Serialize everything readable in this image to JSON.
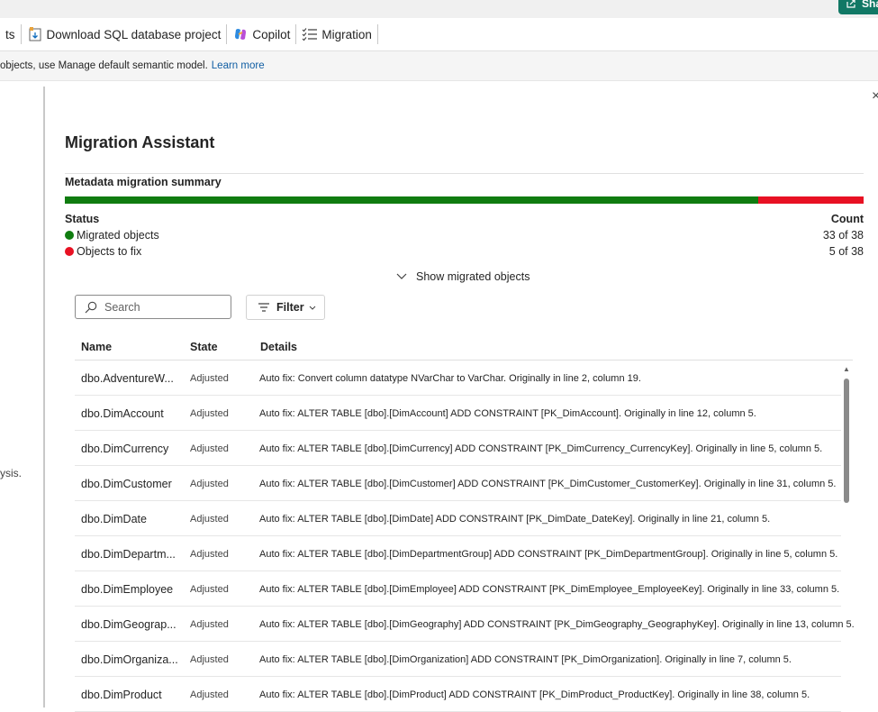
{
  "share": {
    "label": "Sha"
  },
  "toolbar": {
    "items": [
      {
        "label": "ts",
        "icon": "none"
      },
      {
        "label": "Download SQL database project",
        "icon": "download-project-icon"
      },
      {
        "label": "Copilot",
        "icon": "copilot-icon"
      },
      {
        "label": "Migration",
        "icon": "migration-list-icon"
      }
    ]
  },
  "infobar": {
    "text": "objects, use Manage default semantic model.",
    "link": "Learn more"
  },
  "leftpane": {
    "fragment": "ysis."
  },
  "panel": {
    "close": "×",
    "title": "Migration Assistant",
    "summary_title": "Metadata migration summary",
    "progress": {
      "migrated_fraction": 0.868
    },
    "status_header": "Status",
    "count_header": "Count",
    "statuses": [
      {
        "label": "Migrated objects",
        "count": "33 of 38",
        "color": "#107c10"
      },
      {
        "label": "Objects to fix",
        "count": "5 of 38",
        "color": "#e81123"
      }
    ],
    "show_migrated": "Show migrated objects",
    "search_placeholder": "Search",
    "filter_label": "Filter",
    "columns": {
      "name": "Name",
      "state": "State",
      "details": "Details"
    },
    "rows": [
      {
        "name": "dbo.AdventureW...",
        "state": "Adjusted",
        "details": "Auto fix: Convert column datatype NVarChar to VarChar. Originally in line 2, column 19."
      },
      {
        "name": "dbo.DimAccount",
        "state": "Adjusted",
        "details": "Auto fix: ALTER TABLE [dbo].[DimAccount] ADD CONSTRAINT [PK_DimAccount]. Originally in line 12, column 5."
      },
      {
        "name": "dbo.DimCurrency",
        "state": "Adjusted",
        "details": "Auto fix: ALTER TABLE [dbo].[DimCurrency] ADD CONSTRAINT [PK_DimCurrency_CurrencyKey]. Originally in line 5, column 5."
      },
      {
        "name": "dbo.DimCustomer",
        "state": "Adjusted",
        "details": "Auto fix: ALTER TABLE [dbo].[DimCustomer] ADD CONSTRAINT [PK_DimCustomer_CustomerKey]. Originally in line 31, column 5."
      },
      {
        "name": "dbo.DimDate",
        "state": "Adjusted",
        "details": "Auto fix: ALTER TABLE [dbo].[DimDate] ADD CONSTRAINT [PK_DimDate_DateKey]. Originally in line 21, column 5."
      },
      {
        "name": "dbo.DimDepartm...",
        "state": "Adjusted",
        "details": "Auto fix: ALTER TABLE [dbo].[DimDepartmentGroup] ADD CONSTRAINT [PK_DimDepartmentGroup]. Originally in line 5, column 5."
      },
      {
        "name": "dbo.DimEmployee",
        "state": "Adjusted",
        "details": "Auto fix: ALTER TABLE [dbo].[DimEmployee] ADD CONSTRAINT [PK_DimEmployee_EmployeeKey]. Originally in line 33, column 5."
      },
      {
        "name": "dbo.DimGeograp...",
        "state": "Adjusted",
        "details": "Auto fix: ALTER TABLE [dbo].[DimGeography] ADD CONSTRAINT [PK_DimGeography_GeographyKey]. Originally in line 13, column 5."
      },
      {
        "name": "dbo.DimOrganiza...",
        "state": "Adjusted",
        "details": "Auto fix: ALTER TABLE [dbo].[DimOrganization] ADD CONSTRAINT [PK_DimOrganization]. Originally in line 7, column 5."
      },
      {
        "name": "dbo.DimProduct",
        "state": "Adjusted",
        "details": "Auto fix: ALTER TABLE [dbo].[DimProduct] ADD CONSTRAINT [PK_DimProduct_ProductKey]. Originally in line 38, column 5."
      }
    ]
  }
}
